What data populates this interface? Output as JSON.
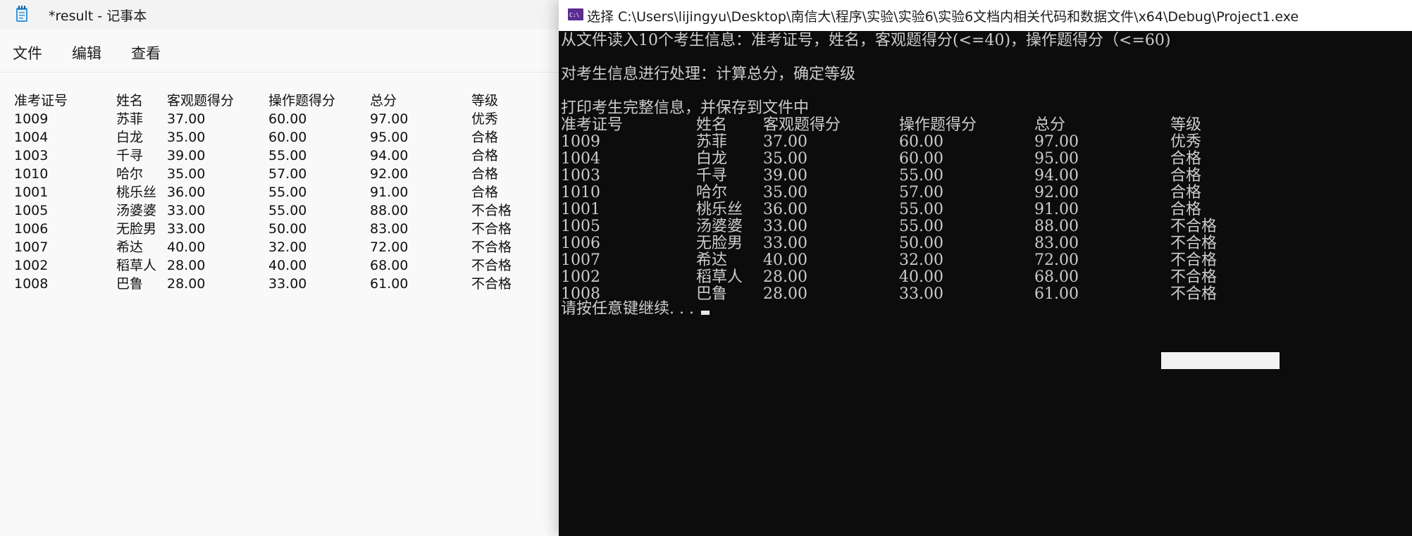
{
  "notepad": {
    "title": "*result - 记事本",
    "menu": [
      "文件",
      "编辑",
      "查看"
    ],
    "headers": [
      "准考证号",
      "姓名",
      "客观题得分",
      "操作题得分",
      "总分",
      "等级"
    ],
    "rows": [
      [
        "1009",
        "苏菲",
        "37.00",
        "60.00",
        "97.00",
        "优秀"
      ],
      [
        "1004",
        "白龙",
        "35.00",
        "60.00",
        "95.00",
        "合格"
      ],
      [
        "1003",
        "千寻",
        "39.00",
        "55.00",
        "94.00",
        "合格"
      ],
      [
        "1010",
        "哈尔",
        "35.00",
        "57.00",
        "92.00",
        "合格"
      ],
      [
        "1001",
        "桃乐丝",
        "36.00",
        "55.00",
        "91.00",
        "合格"
      ],
      [
        "1005",
        "汤婆婆",
        "33.00",
        "55.00",
        "88.00",
        "不合格"
      ],
      [
        "1006",
        "无脸男",
        "33.00",
        "50.00",
        "83.00",
        "不合格"
      ],
      [
        "1007",
        "希达",
        "40.00",
        "32.00",
        "72.00",
        "不合格"
      ],
      [
        "1002",
        "稻草人",
        "28.00",
        "40.00",
        "68.00",
        "不合格"
      ],
      [
        "1008",
        "巴鲁",
        "28.00",
        "33.00",
        "61.00",
        "不合格"
      ]
    ]
  },
  "console": {
    "title": "选择 C:\\Users\\lijingyu\\Desktop\\南信大\\程序\\实验\\实验6\\实验6文档内相关代码和数据文件\\x64\\Debug\\Project1.exe",
    "icon_text": "C:\\",
    "lines": [
      "从文件读入10个考生信息：准考证号，姓名，客观题得分(<=40)，操作题得分（<=60)",
      "对考生信息进行处理：计算总分，确定等级",
      "打印考生完整信息，并保存到文件中"
    ],
    "headers": [
      "准考证号",
      "姓名",
      "客观题得分",
      "操作题得分",
      "总分",
      "等级"
    ],
    "rows": [
      [
        "1009",
        "苏菲",
        "37.00",
        "60.00",
        "97.00",
        "优秀"
      ],
      [
        "1004",
        "白龙",
        "35.00",
        "60.00",
        "95.00",
        "合格"
      ],
      [
        "1003",
        "千寻",
        "39.00",
        "55.00",
        "94.00",
        "合格"
      ],
      [
        "1010",
        "哈尔",
        "35.00",
        "57.00",
        "92.00",
        "合格"
      ],
      [
        "1001",
        "桃乐丝",
        "36.00",
        "55.00",
        "91.00",
        "合格"
      ],
      [
        "1005",
        "汤婆婆",
        "33.00",
        "55.00",
        "88.00",
        "不合格"
      ],
      [
        "1006",
        "无脸男",
        "33.00",
        "50.00",
        "83.00",
        "不合格"
      ],
      [
        "1007",
        "希达",
        "40.00",
        "32.00",
        "72.00",
        "不合格"
      ],
      [
        "1002",
        "稻草人",
        "28.00",
        "40.00",
        "68.00",
        "不合格"
      ],
      [
        "1008",
        "巴鲁",
        "28.00",
        "33.00",
        "61.00",
        "不合格"
      ]
    ],
    "prompt": "请按任意键继续. . ."
  },
  "colors": {
    "console_bg": "#0c0c0c",
    "console_fg": "#cccccc",
    "notepad_bg": "#f9f9f9",
    "titlebar_bg": "#ffffff",
    "console_icon_bg": "#5c2d91"
  },
  "icons": [
    "notepad-icon",
    "console-icon"
  ]
}
